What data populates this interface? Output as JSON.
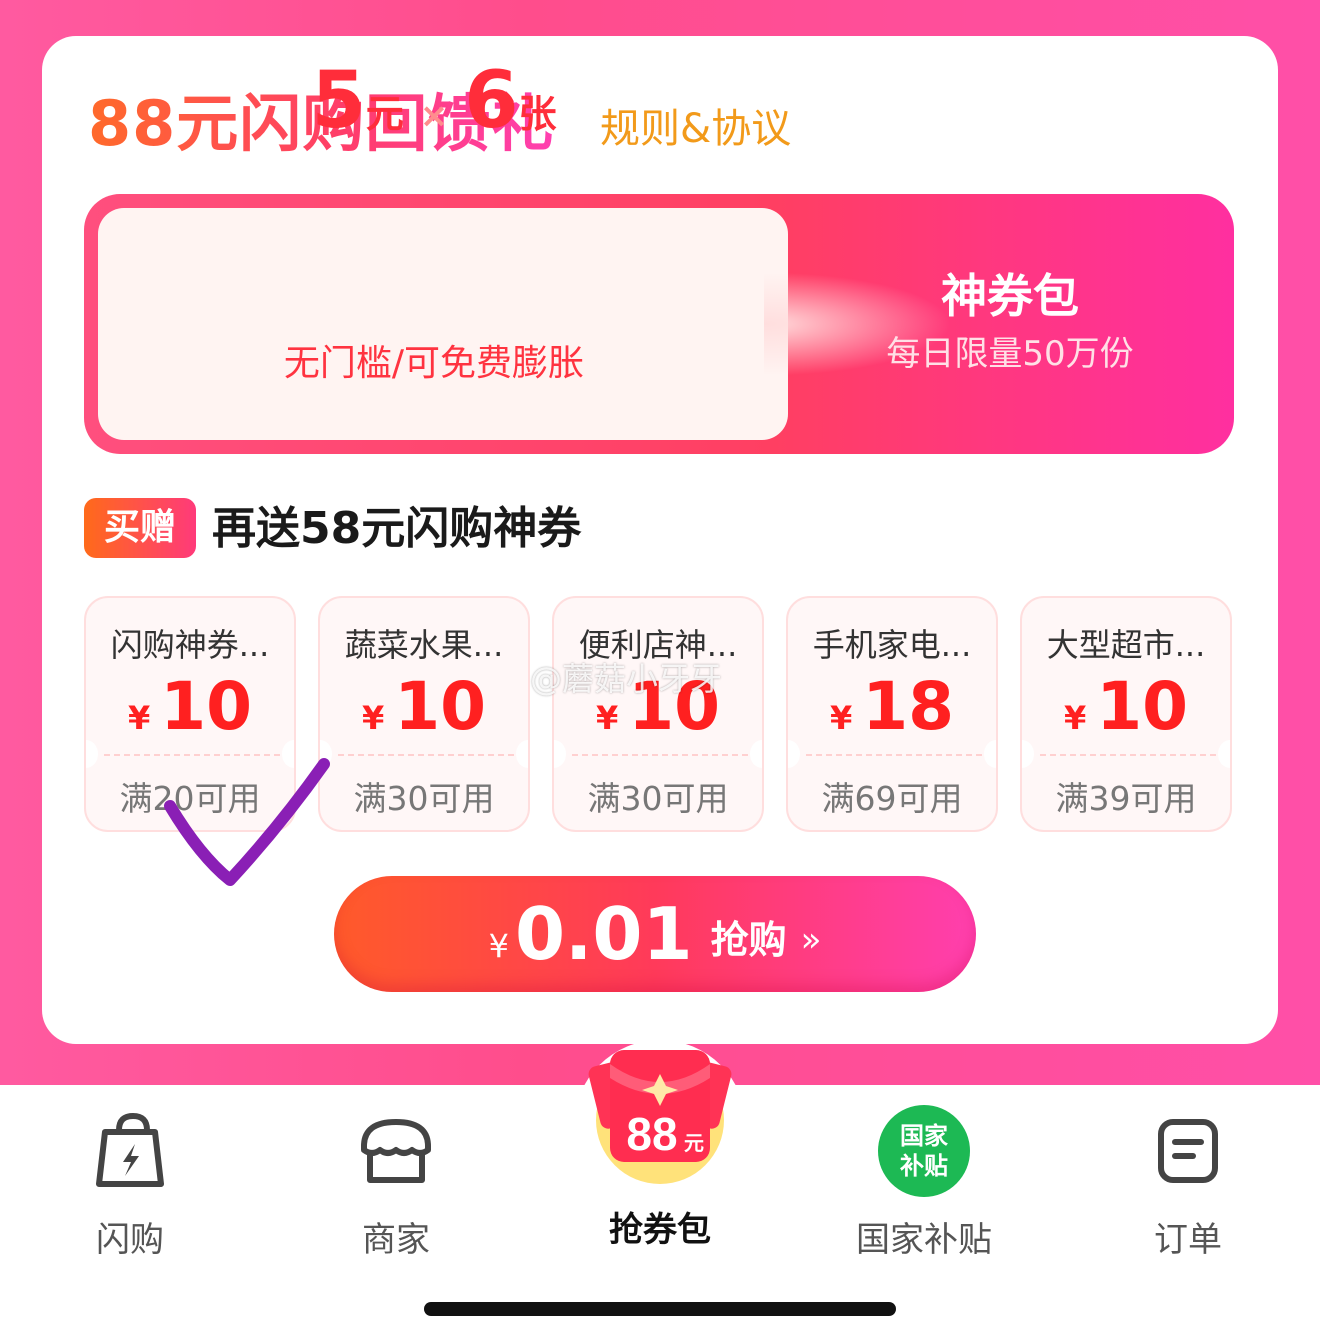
{
  "header": {
    "title": "88元闪购回馈礼",
    "rules_link": "规则&协议"
  },
  "main_coupon": {
    "amount": "5",
    "amount_unit": "元",
    "times": "×",
    "count": "6",
    "count_unit": "张",
    "subtitle": "无门槛/可免费膨胀",
    "pack_title": "神券包",
    "pack_limit": "每日限量50万份"
  },
  "bonus": {
    "badge": "买赠",
    "text": "再送58元闪购神券"
  },
  "coupons": [
    {
      "name": "闪购神券...",
      "currency": "¥",
      "amount": "10",
      "condition": "满20可用"
    },
    {
      "name": "蔬菜水果...",
      "currency": "¥",
      "amount": "10",
      "condition": "满30可用"
    },
    {
      "name": "便利店神...",
      "currency": "¥",
      "amount": "10",
      "condition": "满30可用"
    },
    {
      "name": "手机家电...",
      "currency": "¥",
      "amount": "18",
      "condition": "满69可用"
    },
    {
      "name": "大型超市...",
      "currency": "¥",
      "amount": "10",
      "condition": "满39可用"
    }
  ],
  "watermark": "@蘑菇小牙牙",
  "cta": {
    "currency": "¥",
    "price": "0.01",
    "label": "抢购",
    "arrows": "»"
  },
  "nav": {
    "items": [
      {
        "label": "闪购",
        "icon": "lightning-bag-icon"
      },
      {
        "label": "商家",
        "icon": "store-icon"
      },
      {
        "label": "抢券包",
        "icon": "red-packet-88-icon",
        "badge_text": "88",
        "badge_unit": "元",
        "active": true
      },
      {
        "label": "国家补贴",
        "icon": "gov-subsidy-icon",
        "badge_line1": "国家",
        "badge_line2": "补贴"
      },
      {
        "label": "订单",
        "icon": "order-list-icon"
      }
    ]
  },
  "colors": {
    "brand_pink": "#ff4d8c",
    "coupon_red": "#ff2020",
    "rules_orange": "#f29a1a",
    "gov_green": "#1db954",
    "check_purple": "#8a1fb5"
  }
}
